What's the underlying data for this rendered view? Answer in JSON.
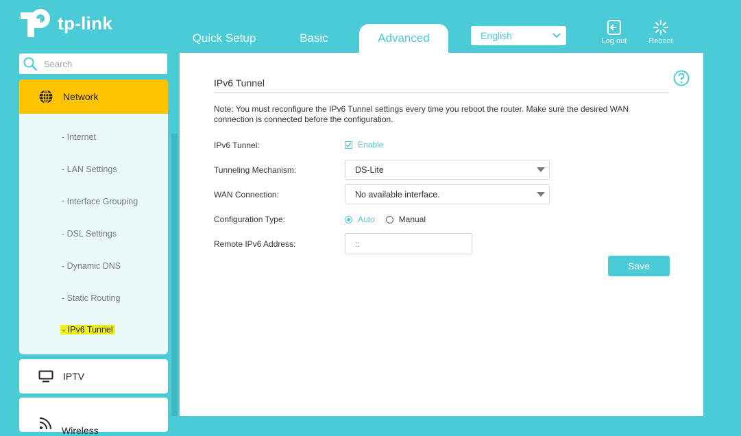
{
  "brand": {
    "logo_text": "tp-link"
  },
  "nav": {
    "tabs": [
      {
        "label": "Quick Setup"
      },
      {
        "label": "Basic"
      },
      {
        "label": "Advanced",
        "active": true
      }
    ],
    "language": "English",
    "logout_label": "Log out",
    "reboot_label": "Reboot"
  },
  "sidebar": {
    "search_placeholder": "Search",
    "network": {
      "label": "Network",
      "items": [
        {
          "label": "- Internet"
        },
        {
          "label": "- LAN Settings"
        },
        {
          "label": "- Interface Grouping"
        },
        {
          "label": "- DSL Settings"
        },
        {
          "label": "- Dynamic DNS"
        },
        {
          "label": "- Static Routing"
        },
        {
          "label": "- IPv6 Tunnel",
          "current": true
        }
      ]
    },
    "iptv_label": "IPTV",
    "wireless_label": "Wireless"
  },
  "main": {
    "title": "IPv6 Tunnel",
    "note": "Note: You must reconfigure the IPv6 Tunnel settings every time you reboot the router. Make sure the desired WAN connection is connected before the configuration.",
    "ipv6_tunnel": {
      "label": "IPv6 Tunnel:",
      "checkbox_label": "Enable",
      "checked": true
    },
    "tunneling_mechanism": {
      "label": "Tunneling Mechanism:",
      "value": "DS-Lite"
    },
    "wan_connection": {
      "label": "WAN Connection:",
      "value": "No available interface."
    },
    "configuration_type": {
      "label": "Configuration Type:",
      "option_auto": "Auto",
      "option_manual": "Manual",
      "selected": "Auto"
    },
    "remote_ipv6": {
      "label": "Remote IPv6 Address:",
      "placeholder": "::"
    },
    "save_label": "Save"
  },
  "colors": {
    "accent": "#4acbd6",
    "highlight": "#ffc300",
    "current_marker": "#f0f020"
  }
}
